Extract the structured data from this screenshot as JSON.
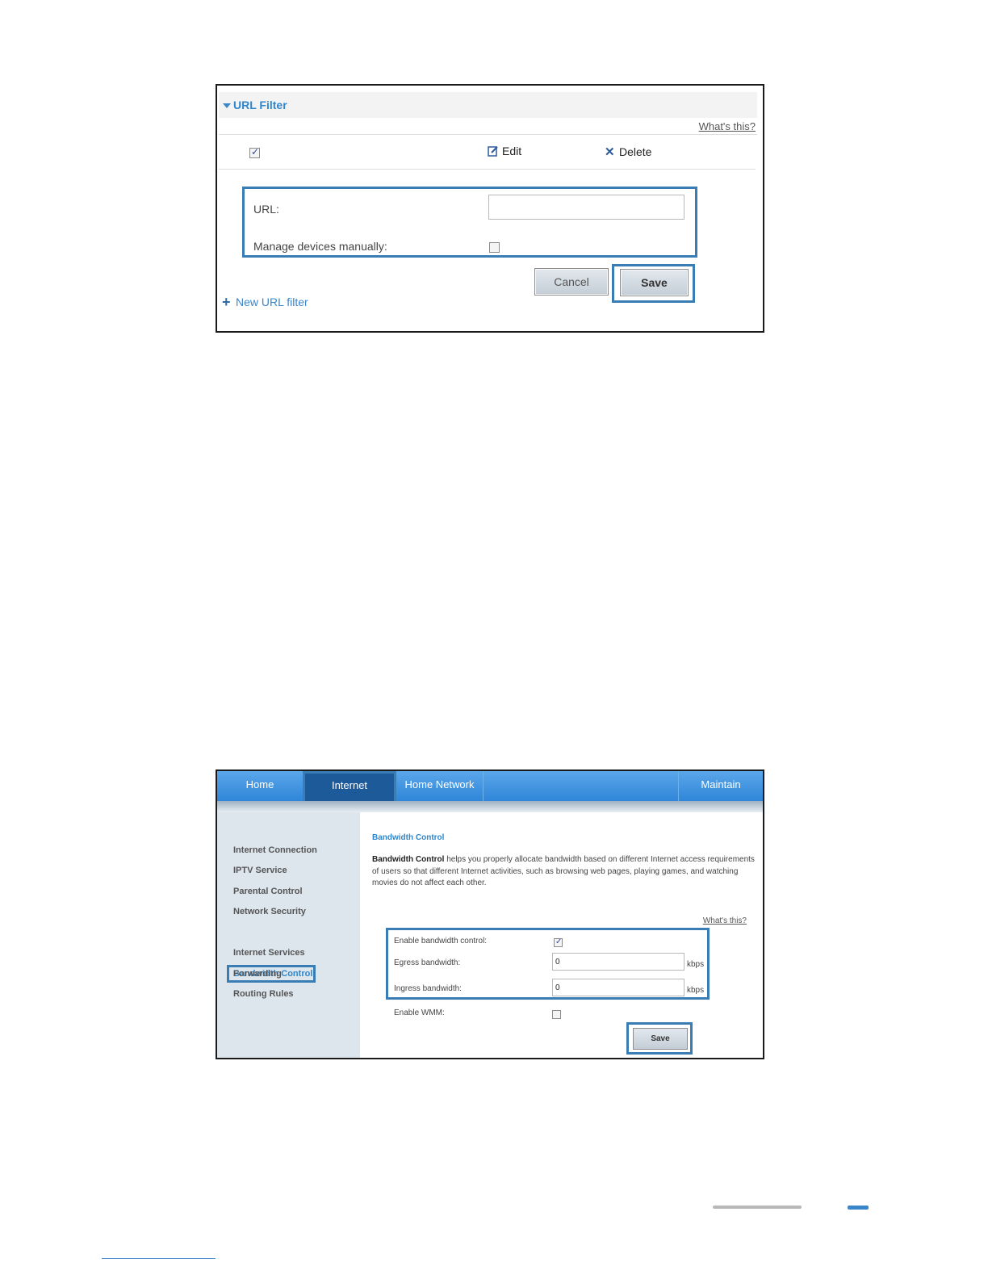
{
  "url_filter": {
    "title": "URL Filter",
    "whats_this": "What's this?",
    "edit_label": "Edit",
    "delete_label": "Delete",
    "url_label": "URL:",
    "url_value": "",
    "manage_label": "Manage devices manually:",
    "select_all_checked": true,
    "manage_checked": false,
    "cancel_label": "Cancel",
    "save_label": "Save",
    "new_filter_label": "New URL filter"
  },
  "bandwidth_page": {
    "nav": {
      "home": "Home",
      "internet": "Internet",
      "home_network": "Home Network",
      "maintain": "Maintain"
    },
    "sidebar": {
      "items": [
        "Internet Connection",
        "IPTV Service",
        "Parental Control",
        "Network Security",
        "Bandwidth Control",
        "Internet Services",
        "Forwarding",
        "Routing Rules"
      ],
      "active": "Bandwidth Control"
    },
    "title": "Bandwidth Control",
    "desc_bold": "Bandwidth Control",
    "desc_text": " helps you properly allocate bandwidth based on different Internet access requirements of users so that different Internet activities, such as browsing web pages, playing games, and watching movies do not affect each other.",
    "whats_this": "What's this?",
    "enable_label": "Enable bandwidth control:",
    "enable_checked": true,
    "egress_label": "Egress bandwidth:",
    "egress_value": "0",
    "ingress_label": "Ingress bandwidth:",
    "ingress_value": "0",
    "unit": "kbps",
    "wmm_label": "Enable WMM:",
    "wmm_checked": false,
    "save_label": "Save"
  },
  "colors": {
    "accent": "#2f86cc",
    "highlight_frame": "#3a7db5",
    "nav_blue": "#2f86d8",
    "nav_active": "#1d5a9a",
    "sidebar_bg": "#dde5ed"
  }
}
